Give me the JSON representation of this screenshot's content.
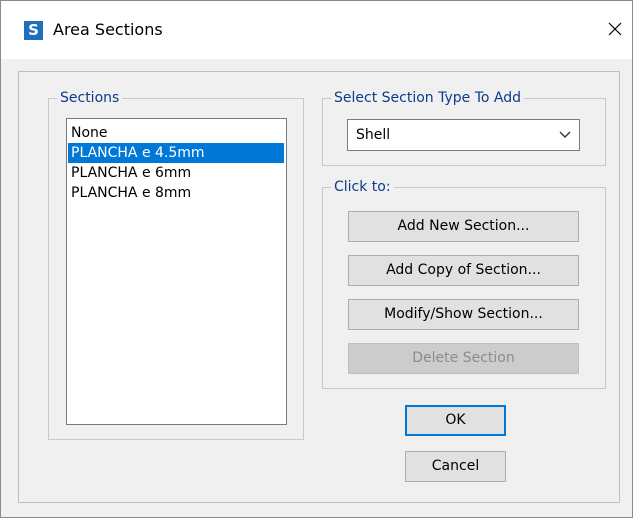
{
  "window": {
    "title": "Area Sections",
    "app_icon_letter": "S"
  },
  "sections_group": {
    "label": "Sections",
    "items": [
      {
        "label": "None",
        "selected": false
      },
      {
        "label": "PLANCHA e 4.5mm",
        "selected": true
      },
      {
        "label": "PLANCHA e 6mm",
        "selected": false
      },
      {
        "label": "PLANCHA e 8mm",
        "selected": false
      }
    ]
  },
  "type_group": {
    "label": "Select Section Type To Add",
    "selected_type": "Shell"
  },
  "click_group": {
    "label": "Click to:",
    "add_new_label": "Add New Section...",
    "add_copy_label": "Add Copy of Section...",
    "modify_label": "Modify/Show Section...",
    "delete_label": "Delete Section"
  },
  "footer": {
    "ok_label": "OK",
    "cancel_label": "Cancel"
  },
  "colors": {
    "selection": "#0078d7",
    "group_label": "#0b3b8c",
    "app_icon": "#1e6fbe"
  }
}
